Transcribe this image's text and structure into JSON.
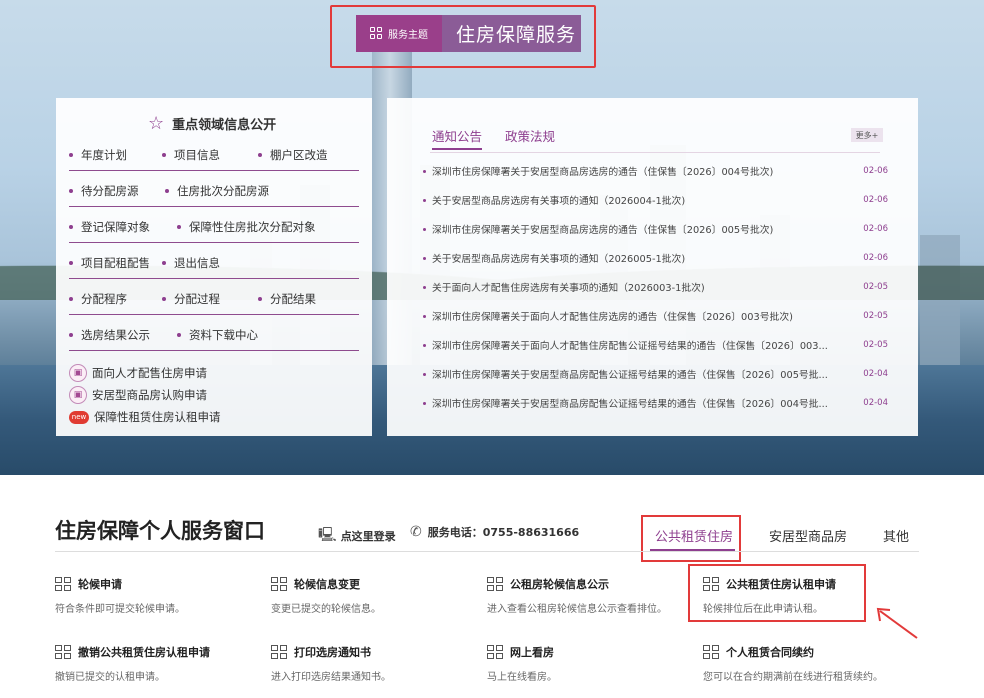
{
  "theme": {
    "tag": "服务主题",
    "title": "住房保障服务"
  },
  "left_panel": {
    "title": "重点领域信息公开",
    "rows": [
      [
        "年度计划",
        "项目信息",
        "棚户区改造"
      ],
      [
        "待分配房源",
        "住房批次分配房源"
      ],
      [
        "登记保障对象",
        "保障性住房批次分配对象"
      ],
      [
        "项目配租配售",
        "退出信息"
      ],
      [
        "分配程序",
        "分配过程",
        "分配结果"
      ],
      [
        "选房结果公示",
        "资料下载中心"
      ]
    ],
    "applications": [
      {
        "icon": "apply-icon",
        "label": "面向人才配售住房申请"
      },
      {
        "icon": "apply-icon",
        "label": "安居型商品房认购申请"
      },
      {
        "icon": "new-badge-icon",
        "badge": "new",
        "label": "保障性租赁住房认租申请"
      }
    ]
  },
  "notices": {
    "tabs": [
      "通知公告",
      "政策法规"
    ],
    "more": "更多+",
    "items": [
      {
        "title": "深圳市住房保障署关于安居型商品房选房的通告（住保售〔2026〕004号批次)",
        "date": "02-06"
      },
      {
        "title": "关于安居型商品房选房有关事项的通知（2026004-1批次)",
        "date": "02-06"
      },
      {
        "title": "深圳市住房保障署关于安居型商品房选房的通告（住保售〔2026〕005号批次)",
        "date": "02-06"
      },
      {
        "title": "关于安居型商品房选房有关事项的通知（2026005-1批次)",
        "date": "02-06"
      },
      {
        "title": "关于面向人才配售住房选房有关事项的通知（2026003-1批次)",
        "date": "02-05"
      },
      {
        "title": "深圳市住房保障署关于面向人才配售住房选房的通告（住保售〔2026〕003号批次)",
        "date": "02-05"
      },
      {
        "title": "深圳市住房保障署关于面向人才配售住房配售公证摇号结果的通告（住保售〔2026〕003...",
        "date": "02-05"
      },
      {
        "title": "深圳市住房保障署关于安居型商品房配售公证摇号结果的通告（住保售〔2026〕005号批...",
        "date": "02-04"
      },
      {
        "title": "深圳市住房保障署关于安居型商品房配售公证摇号结果的通告（住保售〔2026〕004号批...",
        "date": "02-04"
      }
    ]
  },
  "service": {
    "title": "住房保障个人服务窗口",
    "login": "点这里登录",
    "phone": "服务电话：0755-88631666",
    "tabs": [
      "公共租赁住房",
      "安居型商品房",
      "其他"
    ],
    "cards": [
      {
        "title": "轮候申请",
        "desc": "符合条件即可提交轮候申请。"
      },
      {
        "title": "轮候信息变更",
        "desc": "变更已提交的轮候信息。"
      },
      {
        "title": "公租房轮候信息公示",
        "desc": "进入查看公租房轮候信息公示查看排位。"
      },
      {
        "title": "公共租赁住房认租申请",
        "desc": "轮候排位后在此申请认租。"
      },
      {
        "title": "撤销公共租赁住房认租申请",
        "desc": "撤销已提交的认租申请。"
      },
      {
        "title": "打印选房通知书",
        "desc": "进入打印选房结果通知书。"
      },
      {
        "title": "网上看房",
        "desc": "马上在线看房。"
      },
      {
        "title": "个人租赁合同续约",
        "desc": "您可以在合约期满前在线进行租赁续约。"
      }
    ]
  },
  "colors": {
    "accent": "#8e3f8f",
    "highlight": "#e23a3a"
  }
}
